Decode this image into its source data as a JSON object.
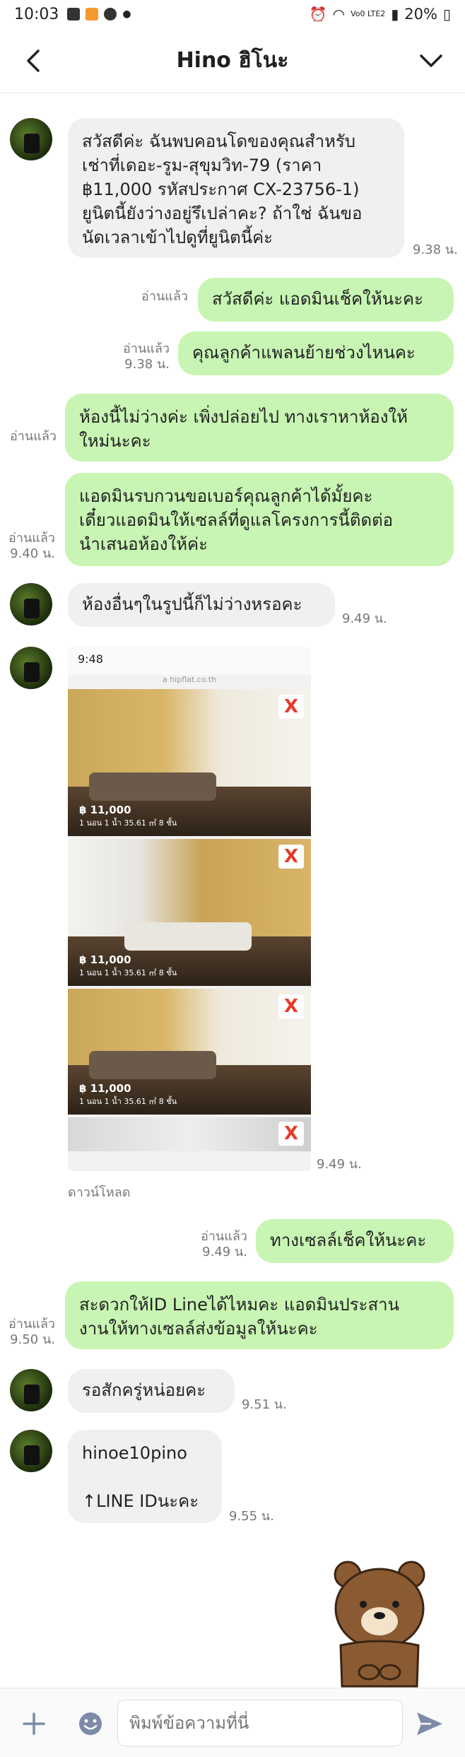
{
  "status": {
    "time": "10:03",
    "network": "Vo0 LTE2",
    "battery": "20%"
  },
  "header": {
    "title": "Hino ฮิโนะ"
  },
  "messages": [
    {
      "text": "สวัสดีค่ะ ฉันพบคอนโดของคุณสำหรับ\nเช่าที่เดอะ-รูม-สุขุมวิท-79 (ราคา\n฿11,000 รหัสประกาศ CX-23756-1)\nยูนิตนี้ยังว่างอยู่รึเปล่าคะ? ถ้าใช่ ฉันขอ\nนัดเวลาเข้าไปดูที่ยูนิตนี้ค่ะ",
      "time": "9.38 น."
    },
    {
      "text": "สวัสดีค่ะ แอดมินเช็คให้นะคะ",
      "read": "อ่านแล้ว"
    },
    {
      "text": "คุณลูกค้าแพลนย้ายช่วงไหนคะ",
      "meta": "อ่านแล้ว\n9.38 น."
    },
    {
      "text": "ห้องนี้ไม่ว่างค่ะ เพิ่งปล่อยไป ทางเราหาห้องให้\nใหม่นะคะ",
      "read": "อ่านแล้ว"
    },
    {
      "text": "แอดมินรบกวนขอเบอร์คุณลูกค้าได้มั้ยคะ\nเดี๋ยวแอดมินให้เซลล์ที่ดูแลโครงการนี้ติดต่อ\nนำเสนอห้องให้ค่ะ",
      "meta": "อ่านแล้ว\n9.40 น."
    },
    {
      "text": "ห้องอื่นๆในรูปนี้ก็ไม่ว่างหรอคะ",
      "time": "9.49 น."
    },
    {
      "text": "ทางเซลล์เช็คให้นะคะ",
      "meta": "อ่านแล้ว\n9.49 น."
    },
    {
      "text": "สะดวกให้ID Lineได้ไหมคะ แอดมินประสาน\nงานให้ทางเซลล์ส่งข้อมูลให้นะคะ",
      "meta": "อ่านแล้ว\n9.50 น."
    },
    {
      "text": "รอสักครู่หน่อยคะ",
      "time": "9.51 น."
    },
    {
      "text": "hinoe10pino\n\n↑LINE IDนะคะ",
      "time": "9.55 น."
    }
  ],
  "image_msg": {
    "time": "9.49 น.",
    "download": "ดาวน์โหลด",
    "shot_time": "9:48",
    "shot_url": "a hipflat.co.th",
    "listings": [
      {
        "price": "฿ 11,000",
        "spec": "1 นอน  1 น้ำ  35.61 ㎡  8 ชั้น"
      },
      {
        "price": "฿ 11,000",
        "spec": "1 นอน  1 น้ำ  35.61 ㎡  8 ชั้น"
      },
      {
        "price": "฿ 11,000",
        "spec": "1 นอน  1 น้ำ  35.61 ㎡  8 ชั้น"
      }
    ],
    "logo": "X"
  },
  "input": {
    "placeholder": "พิมพ์ข้อความที่นี่"
  },
  "colors": {
    "outgoing": "#c8f5b3",
    "incoming": "#f0f0f0",
    "send": "#7d8aa8"
  }
}
